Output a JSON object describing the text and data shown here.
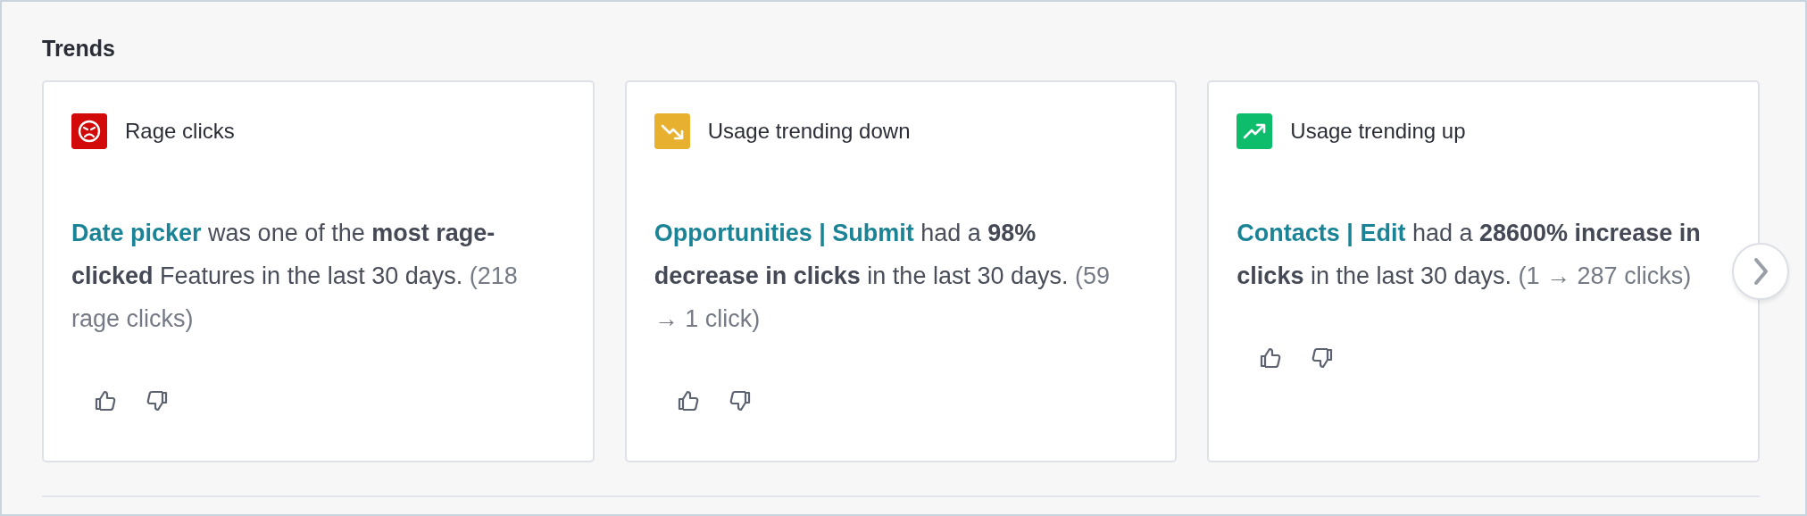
{
  "section": {
    "title": "Trends"
  },
  "cards": [
    {
      "kind": "rage",
      "color": "#d20a0a",
      "heading": "Rage clicks",
      "link": "Date picker",
      "text": "was one of the **most rage-clicked** Features in the last 30 days.",
      "detail": "(218 rage clicks)"
    },
    {
      "kind": "down",
      "color": "#e8b02f",
      "heading": "Usage trending down",
      "link": "Opportunities | Submit",
      "text": "had a **98% decrease in clicks** in the last 30 days.",
      "detail": "(59 → 1 click)"
    },
    {
      "kind": "up",
      "color": "#0dbd6b",
      "heading": "Usage trending up",
      "link": "Contacts | Edit",
      "text": "had a **28600% increase in clicks** in the last 30 days.",
      "detail": "(1 → 287 clicks)"
    }
  ],
  "carousel": {
    "has_next": true
  }
}
